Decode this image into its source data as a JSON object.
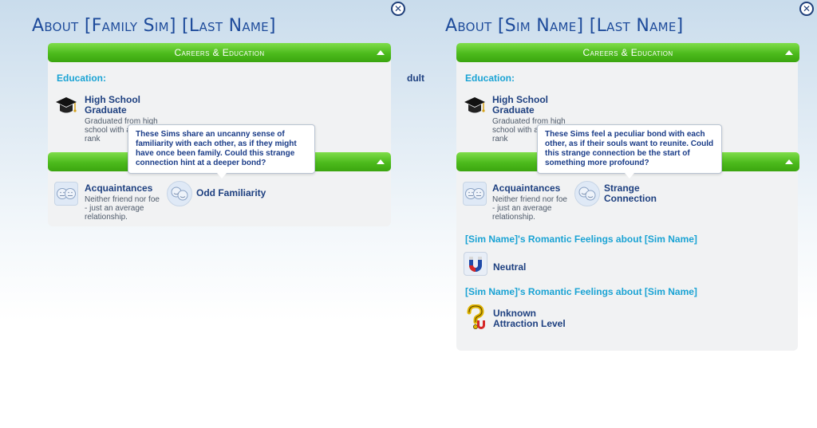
{
  "left": {
    "title": "About [Family Sim] [Last Name]",
    "careers_header": "Careers & Education",
    "education_label": "Education:",
    "education_title": "High School Graduate",
    "education_desc": "Graduated from high school with a class rank",
    "tooltip": "These Sims share an uncanny sense of familiarity with each other, as if they might have once been family. Could this strange connection hint at a deeper bond?",
    "relationship_title": "Acquaintances",
    "relationship_desc": "Neither friend nor foe - just an average relationship.",
    "bond_label": "Odd Familiarity",
    "edge_fragment": "dult"
  },
  "right": {
    "title": "About [Sim Name] [Last Name]",
    "careers_header": "Careers & Education",
    "education_label": "Education:",
    "education_title": "High School Graduate",
    "education_desc": "Graduated from high school with a class rank",
    "tooltip": "These Sims feel a peculiar bond with each other, as if their souls want to reunite. Could this strange connection be the start of something more profound?",
    "relationship_title": "Acquaintances",
    "relationship_desc": "Neither friend nor foe - just an average relationship.",
    "bond_label": "Strange Connection",
    "romance_heading_1": "[Sim Name]'s Romantic Feelings about [Sim Name]",
    "romance_value_1": "Neutral",
    "romance_heading_2": "[Sim Name]'s Romantic Feelings about [Sim Name]",
    "romance_value_2": "Unknown Attraction Level"
  },
  "icons": {
    "close": "close-icon",
    "education": "graduation-cap-icon",
    "acquaintance": "neutral-faces-icon",
    "bond": "smiling-faces-icon",
    "romance_neutral": "magnet-icon",
    "romance_unknown": "question-magnet-icon"
  },
  "colors": {
    "header_green": "#4cba1c",
    "title_blue": "#1e4b9b",
    "label_cyan": "#1aa3d4",
    "card_bg": "#f1f2f3"
  }
}
